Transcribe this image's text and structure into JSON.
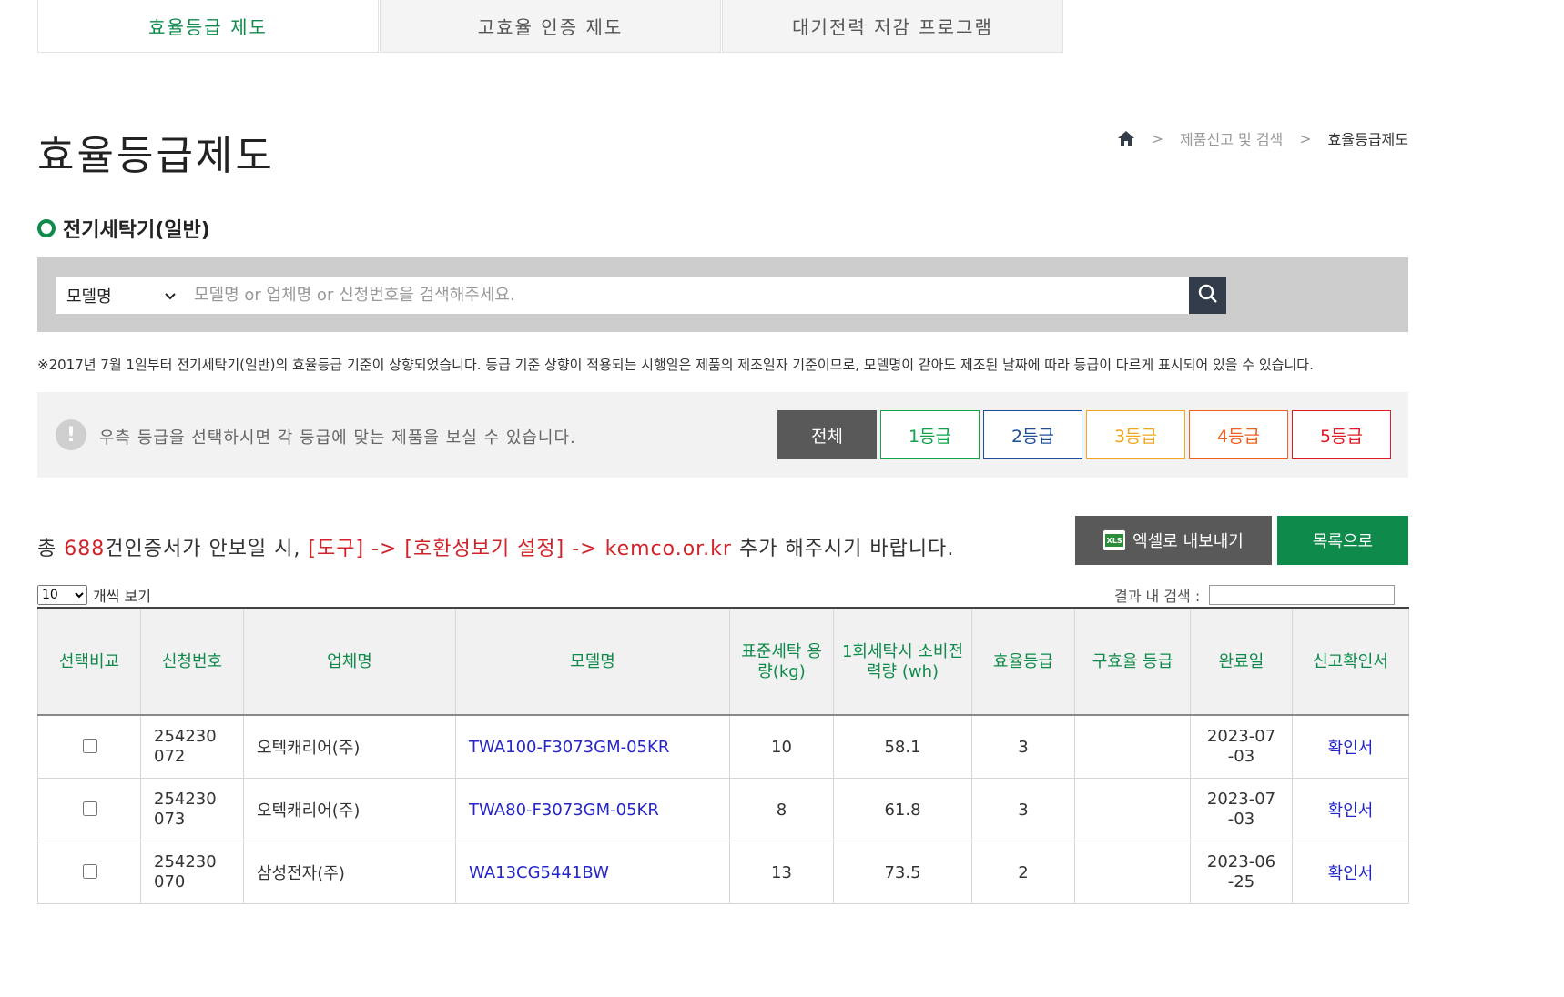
{
  "tabs": [
    {
      "label": "효율등급 제도"
    },
    {
      "label": "고효율 인증 제도"
    },
    {
      "label": "대기전력 저감 프로그램"
    }
  ],
  "page_title": "효율등급제도",
  "breadcrumb": {
    "level1": "제품신고 및 검색",
    "current": "효율등급제도",
    "sep": ">"
  },
  "section_title": "전기세탁기(일반)",
  "search": {
    "select_value": "모델명",
    "placeholder": "모델명 or 업체명 or 신청번호을 검색해주세요."
  },
  "notice": "※2017년 7월 1일부터 전기세탁기(일반)의 효율등급 기준이 상향되었습니다. 등급 기준 상향이 적용되는 시행일은 제품의 제조일자 기준이므로, 모델명이 같아도 제조된 날짜에 따라 등급이 다르게 표시되어 있을 수 있습니다.",
  "grade_filter": {
    "info_text": "우측 등급을 선택하시면 각 등급에 맞는 제품을 보실 수 있습니다.",
    "buttons": [
      {
        "label": "전체",
        "color": "#595959"
      },
      {
        "label": "1등급",
        "color": "#11a24a"
      },
      {
        "label": "2등급",
        "color": "#1f4f99"
      },
      {
        "label": "3등급",
        "color": "#f2a61d"
      },
      {
        "label": "4등급",
        "color": "#f0601e"
      },
      {
        "label": "5등급",
        "color": "#e01b24"
      }
    ]
  },
  "summary": {
    "prefix": "총",
    "count": "688",
    "suffix": "건",
    "message_a": "인증서가 안보일 시,",
    "message_red": "[도구] -> [호환성보기 설정] -> kemco.or.kr",
    "message_b": "추가 해주시기 바랍니다."
  },
  "actions": {
    "excel": "엑셀로 내보내기",
    "list": "목록으로",
    "xls_badge": "XLS"
  },
  "page_size": {
    "value": "10",
    "label": "개씩 보기"
  },
  "result_search": {
    "label": "결과 내 검색 :"
  },
  "table": {
    "headers": [
      "선택비교",
      "신청번호",
      "업체명",
      "모델명",
      "표준세탁 용량(kg)",
      "1회세탁시 소비전력량 (wh)",
      "효율등급",
      "구효율 등급",
      "완료일",
      "신고확인서"
    ],
    "rows": [
      {
        "app_no": "254230072",
        "company": "오텍캐리어(주)",
        "model": "TWA100-F3073GM-05KR",
        "capacity": "10",
        "power": "58.1",
        "grade": "3",
        "old_grade": "",
        "date": "2023-07-03",
        "cert": "확인서"
      },
      {
        "app_no": "254230073",
        "company": "오텍캐리어(주)",
        "model": "TWA80-F3073GM-05KR",
        "capacity": "8",
        "power": "61.8",
        "grade": "3",
        "old_grade": "",
        "date": "2023-07-03",
        "cert": "확인서"
      },
      {
        "app_no": "254230070",
        "company": "삼성전자(주)",
        "model": "WA13CG5441BW",
        "capacity": "13",
        "power": "73.5",
        "grade": "2",
        "old_grade": "",
        "date": "2023-06-25",
        "cert": "확인서"
      }
    ]
  }
}
